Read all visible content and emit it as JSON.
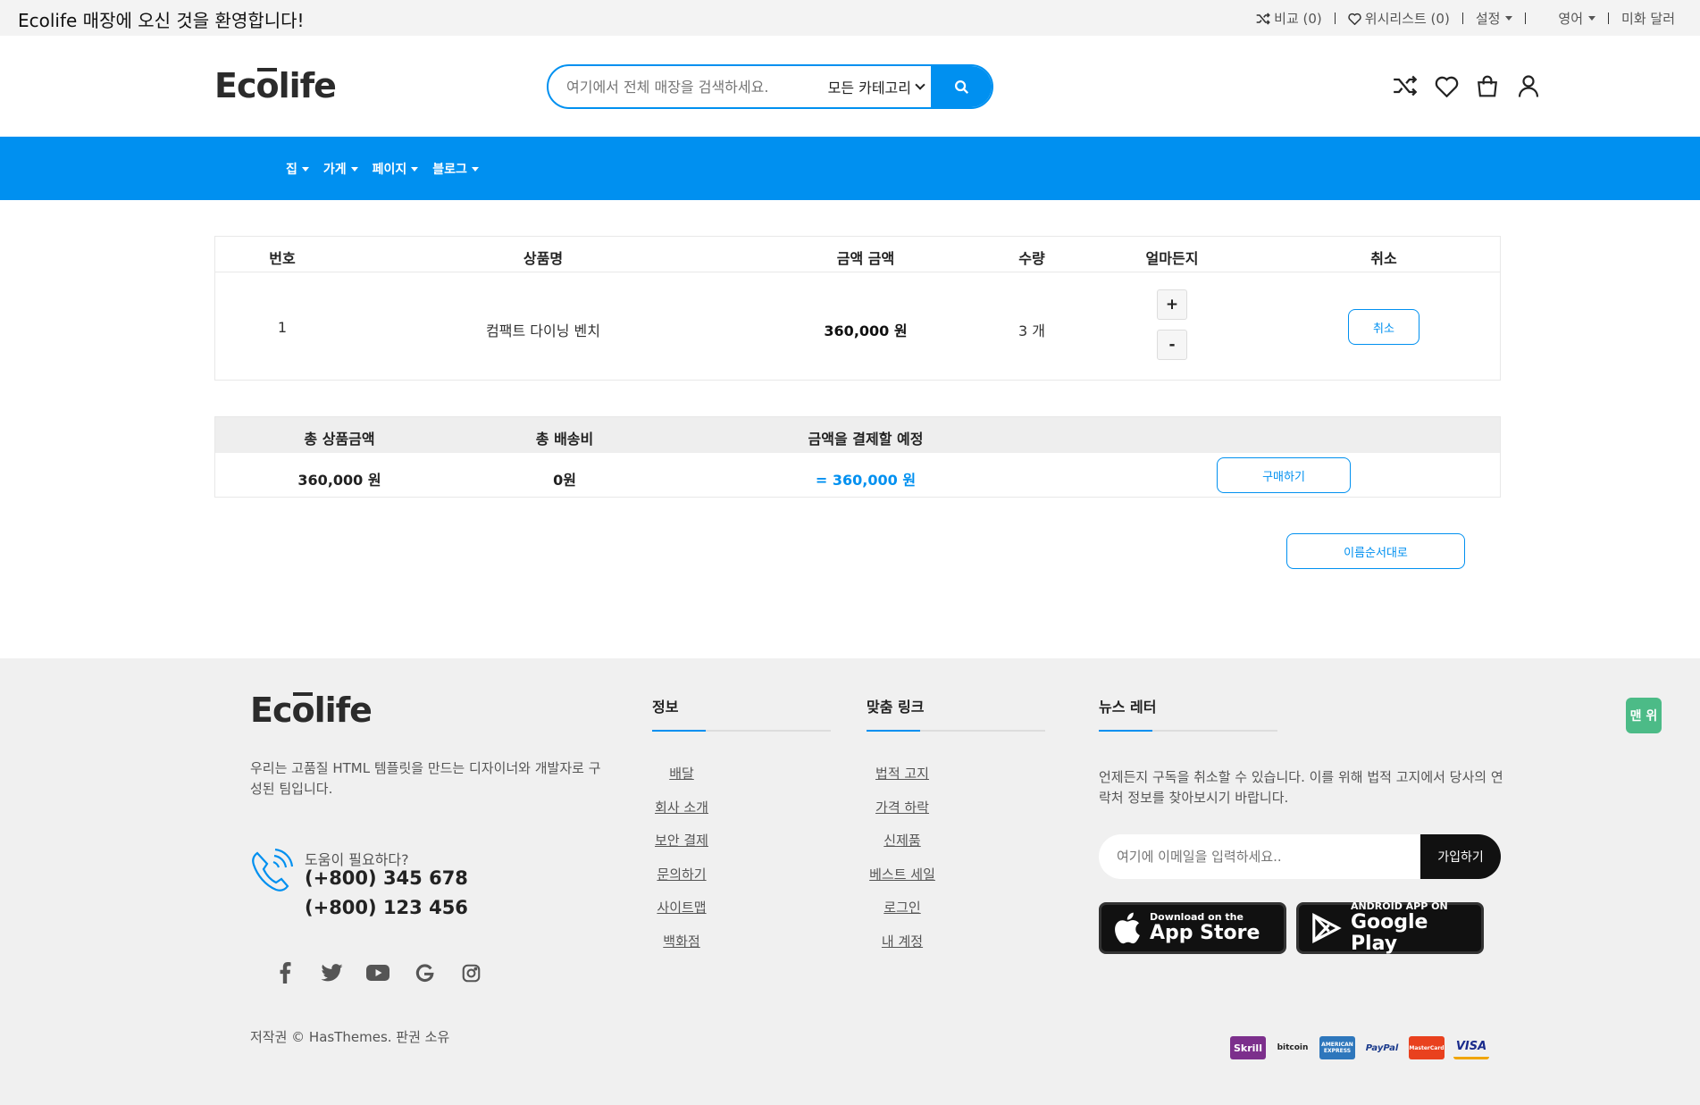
{
  "topbar": {
    "welcome": "Ecolife 매장에 오신 것을 환영합니다!",
    "compare": "비교 (0)",
    "wishlist": "위시리스트 (0)",
    "settings": "설정",
    "language": "영어",
    "currency": "미화 달러"
  },
  "header": {
    "logo": {
      "pre": "Ec",
      "o": "o",
      "post": "life"
    },
    "search_placeholder": "여기에서 전체 매장을 검색하세요.",
    "category": "모든 카테고리"
  },
  "nav": {
    "items": [
      "집",
      "가게",
      "페이지",
      "블로그"
    ]
  },
  "cart": {
    "headers": {
      "no": "번호",
      "name": "상품명",
      "price": "금액 금액",
      "qty": "수량",
      "adjust": "얼마든지",
      "cancel": "취소"
    },
    "row": {
      "no": "1",
      "name": "컴팩트 다이닝 벤치",
      "price": "360,000 원",
      "qty": "3 개",
      "plus": "+",
      "minus": "-",
      "cancel_btn": "취소"
    }
  },
  "summary": {
    "headers": {
      "total_products": "총 상품금액",
      "shipping": "총 배송비",
      "payment": "금액을 결제할 예정"
    },
    "values": {
      "total_products": "360,000 원",
      "shipping": "0원",
      "payment": "= 360,000 원"
    },
    "buy_btn": "구매하기",
    "order_btn": "이름순서대로"
  },
  "footer": {
    "logo": {
      "pre": "Ec",
      "o": "o",
      "post": "life"
    },
    "about": "우리는 고품질 HTML 템플릿을 만드는 디자이너와 개발자로 구성된 팀입니다.",
    "help_label": "도움이 필요하다?",
    "phone1": "(+800) 345 678",
    "phone2": "(+800) 123 456",
    "copyright": "저작권 © HasThemes. 판권 소유",
    "info_title": "정보",
    "info_links": [
      "배달",
      "회사 소개",
      "보안 결제",
      "문의하기",
      "사이트맵",
      "백화점"
    ],
    "custom_title": "맞춤 링크",
    "custom_links": [
      "법적 고지",
      "가격 하락",
      "신제품",
      "베스트 세일",
      "로그인",
      "내 계정"
    ],
    "newsletter_title": "뉴스 레터",
    "newsletter_text": "언제든지 구독을 취소할 수 있습니다. 이를 위해 법적 고지에서 당사의 연락처 정보를 찾아보시기 바랍니다.",
    "email_placeholder": "여기에 이메일을 입력하세요..",
    "subscribe": "가입하기",
    "appstore": {
      "small": "Download on the",
      "big": "App Store"
    },
    "googleplay": {
      "small": "ANDROID APP ON",
      "big": "Google Play"
    },
    "payments": [
      "Skrill",
      "bitcoin",
      "AMERICAN EXPRESS",
      "PayPal",
      "MasterCard",
      "VISA"
    ],
    "to_top": "맨 위"
  },
  "colors": {
    "accent": "#0090f0",
    "to_top": "#4cbb87"
  }
}
